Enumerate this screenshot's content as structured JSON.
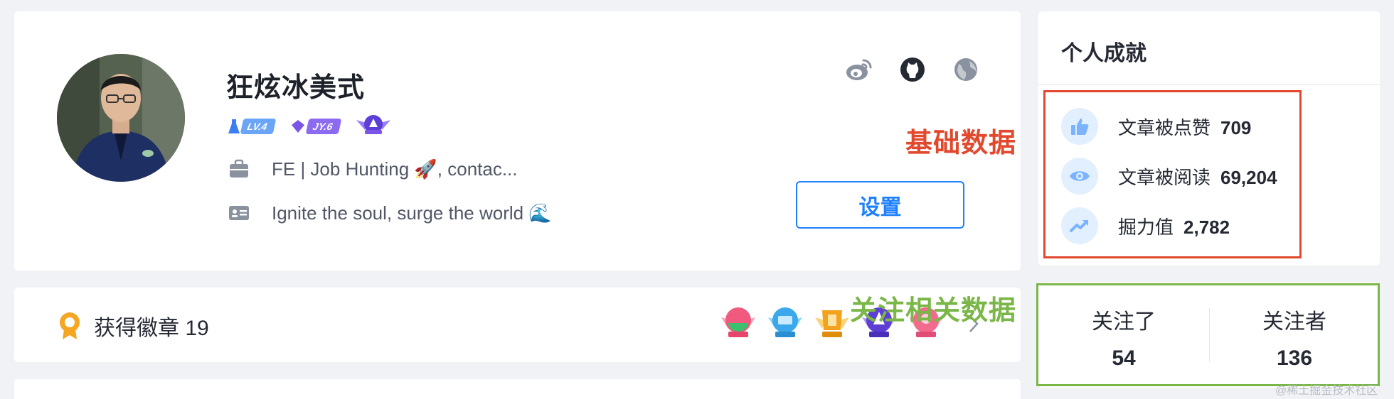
{
  "profile": {
    "name": "狂炫冰美式",
    "levels": [
      {
        "label": "LV.4",
        "color": "#6aa5f7"
      },
      {
        "label": "JY.6",
        "color": "#8c6bf1"
      }
    ],
    "job": "FE  |  Job Hunting 🚀, contac...",
    "bio": "Ignite the soul, surge the world 🌊",
    "settings_label": "设置",
    "social_icons": [
      "weibo-icon",
      "github-icon",
      "globe-icon"
    ]
  },
  "annotations": {
    "basic_data": "基础数据",
    "follow_data": "关注相关数据"
  },
  "badges": {
    "title": "获得徽章 19"
  },
  "achievements": {
    "title": "个人成就",
    "items": [
      {
        "icon": "thumbs-up-icon",
        "label": "文章被点赞",
        "value": "709"
      },
      {
        "icon": "eye-icon",
        "label": "文章被阅读",
        "value": "69,204"
      },
      {
        "icon": "trend-icon",
        "label": "掘力值",
        "value": "2,782"
      }
    ]
  },
  "follow": {
    "items": [
      {
        "label": "关注了",
        "count": "54"
      },
      {
        "label": "关注者",
        "count": "136"
      }
    ]
  },
  "watermark": "@稀土掘金技术社区",
  "colors": {
    "accent": "#1e80ff",
    "annotation_red": "#e2482d",
    "annotation_green": "#7ab648"
  }
}
